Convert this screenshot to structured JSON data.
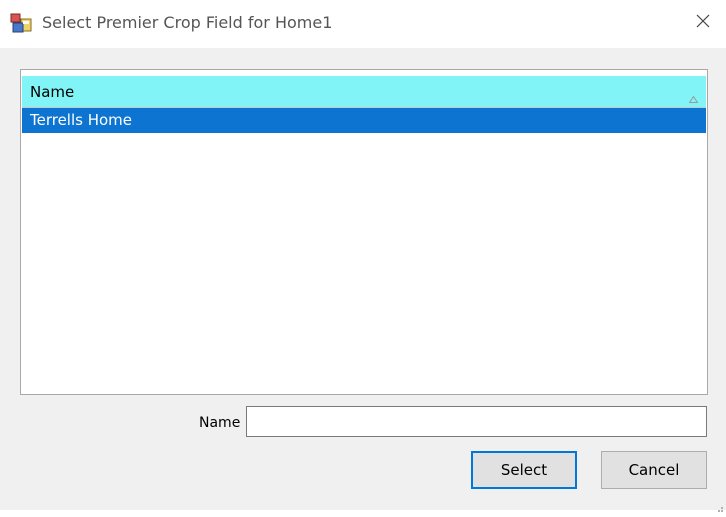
{
  "window": {
    "title": "Select Premier Crop Field for Home1"
  },
  "list": {
    "columns": [
      {
        "label": "Name",
        "sort": "ascending"
      }
    ],
    "rows": [
      {
        "name": "Terrells Home",
        "selected": true
      }
    ]
  },
  "form": {
    "name_label": "Name",
    "name_value": "",
    "name_placeholder": ""
  },
  "buttons": {
    "select_label": "Select",
    "cancel_label": "Cancel"
  },
  "colors": {
    "header_bg": "#80f4f6",
    "selection_bg": "#0d74d1",
    "default_button_border": "#0078d7"
  },
  "icons": {
    "app": "app-window-icon",
    "close": "close-icon",
    "sort": "sort-ascending-icon",
    "grip": "resize-grip-icon"
  }
}
